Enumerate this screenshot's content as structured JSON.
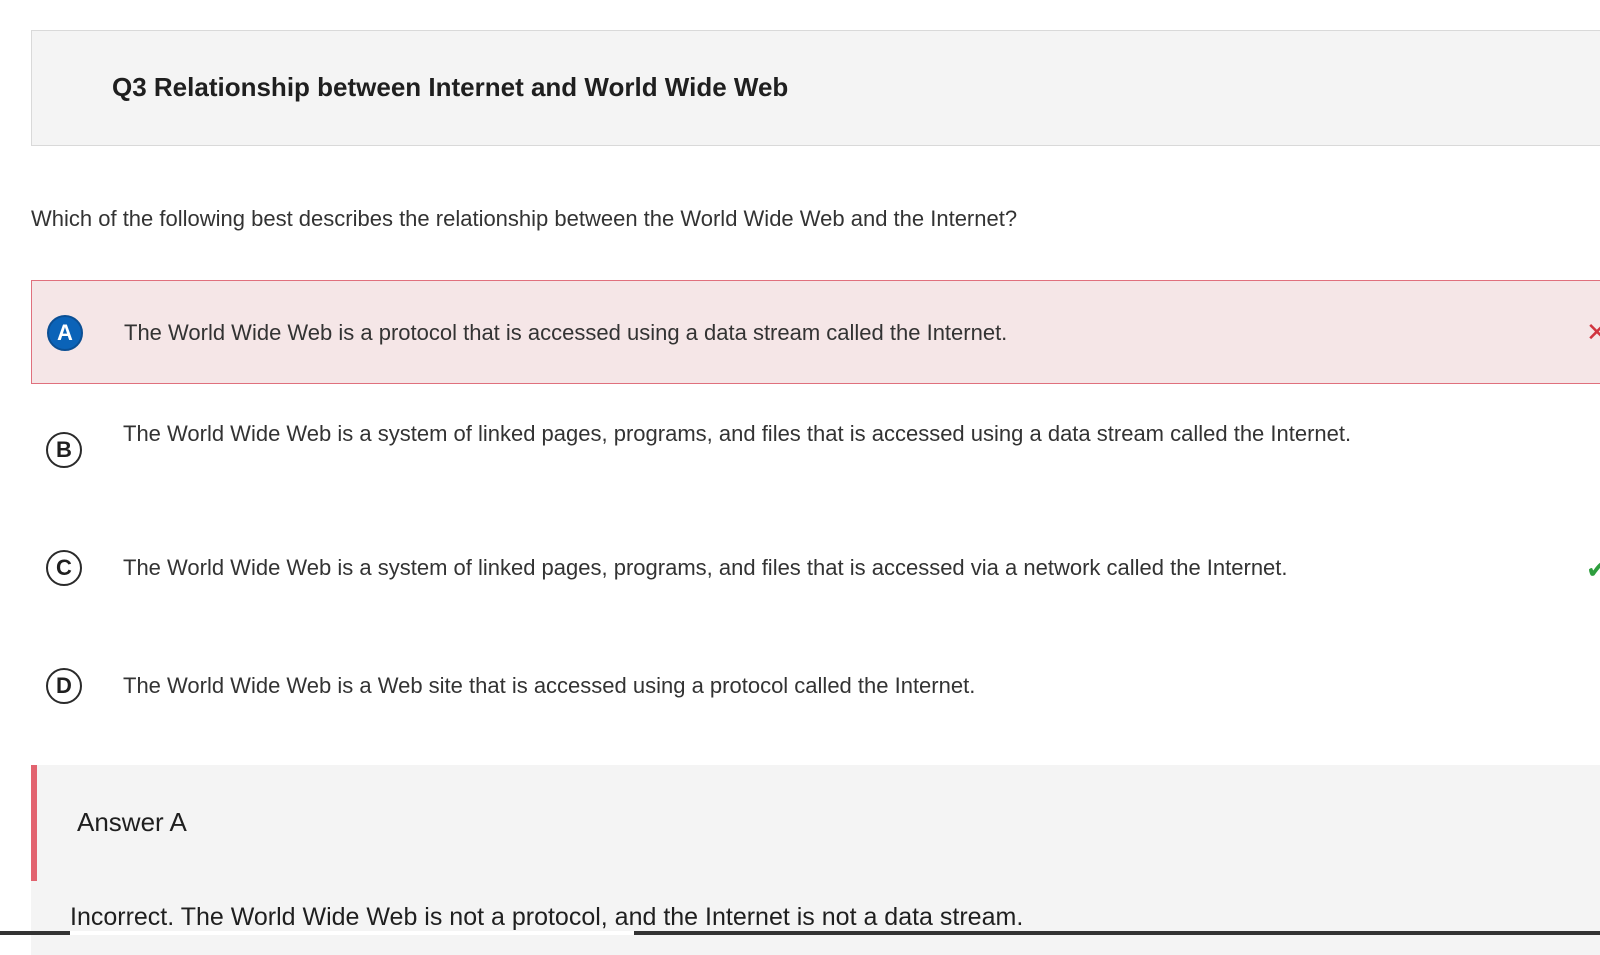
{
  "question": {
    "title": "Q3 Relationship between Internet and World Wide Web",
    "prompt": "Which of the following best describes the relationship between the World Wide Web and the Internet?"
  },
  "options": [
    {
      "letter": "A",
      "text": "The World Wide Web is a protocol that is accessed using a data stream called the Internet.",
      "selected": true,
      "mark": "✕",
      "mark_icon": "x-icon"
    },
    {
      "letter": "B",
      "text": "The World Wide Web is a system of linked pages, programs, and files that is accessed using a data stream called the Internet.",
      "selected": false,
      "mark": "",
      "mark_icon": ""
    },
    {
      "letter": "C",
      "text": "The World Wide Web is a system of linked pages, programs, and files that is accessed via a network called the Internet.",
      "selected": false,
      "mark": "✔",
      "mark_icon": "check-icon"
    },
    {
      "letter": "D",
      "text": "The World Wide Web is a Web site that is accessed using a protocol called the Internet.",
      "selected": false,
      "mark": "",
      "mark_icon": ""
    }
  ],
  "feedback": {
    "title": "Answer A",
    "text": "Incorrect. The World Wide Web is not a protocol, and the Internet is not a data stream."
  },
  "colors": {
    "selected_badge": "#0b63b8",
    "wrong_border": "#e0707d",
    "wrong_background": "#f5e6e7",
    "wrong_mark": "#d0343f",
    "right_mark": "#2e9e3e",
    "feedback_bar": "#e2636f"
  }
}
